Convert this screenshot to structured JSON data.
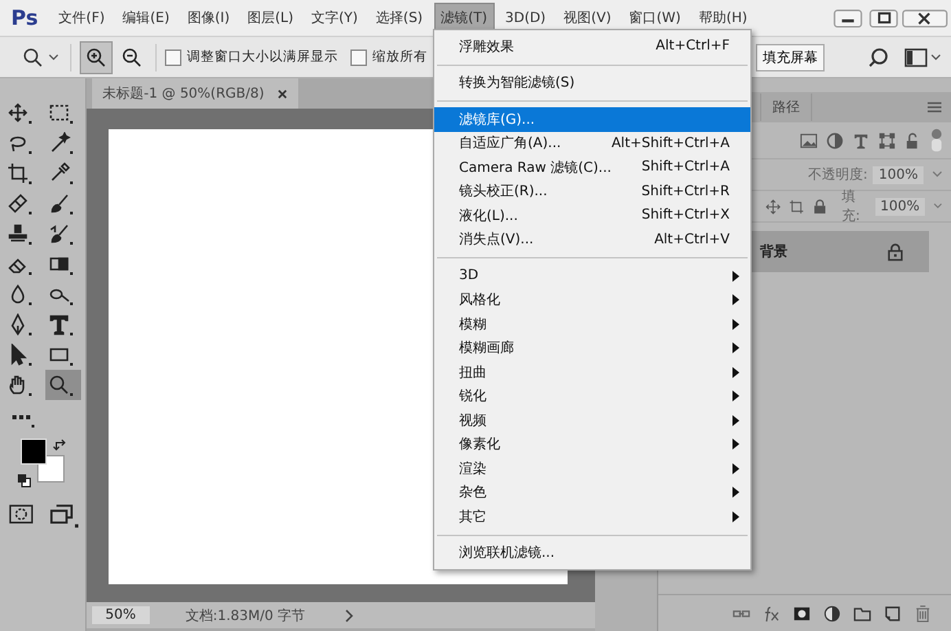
{
  "menubar": {
    "logo": "Ps",
    "items": [
      {
        "label": "文件(F)",
        "selected": false
      },
      {
        "label": "编辑(E)",
        "selected": false
      },
      {
        "label": "图像(I)",
        "selected": false
      },
      {
        "label": "图层(L)",
        "selected": false
      },
      {
        "label": "文字(Y)",
        "selected": false
      },
      {
        "label": "选择(S)",
        "selected": false
      },
      {
        "label": "滤镜(T)",
        "selected": true
      },
      {
        "label": "3D(D)",
        "selected": false
      },
      {
        "label": "视图(V)",
        "selected": false
      },
      {
        "label": "窗口(W)",
        "selected": false
      },
      {
        "label": "帮助(H)",
        "selected": false
      }
    ]
  },
  "options_bar": {
    "modes": [
      {
        "kind": "zoom-in",
        "selected": true
      },
      {
        "kind": "zoom-out",
        "selected": false
      }
    ],
    "checkboxes": [
      {
        "label": "调整窗口大小以满屏显示",
        "checked": false
      },
      {
        "label": "缩放所有",
        "checked": false
      }
    ],
    "fill_screen_button": "填充屏幕"
  },
  "tools": [
    {
      "kind": "move",
      "selected": false
    },
    {
      "kind": "marquee",
      "selected": false
    },
    {
      "kind": "lasso",
      "selected": false
    },
    {
      "kind": "wand",
      "selected": false
    },
    {
      "kind": "crop",
      "selected": false
    },
    {
      "kind": "eyedropper",
      "selected": false
    },
    {
      "kind": "healing",
      "selected": false
    },
    {
      "kind": "brush",
      "selected": false
    },
    {
      "kind": "stamp",
      "selected": false
    },
    {
      "kind": "history",
      "selected": false
    },
    {
      "kind": "eraser",
      "selected": false
    },
    {
      "kind": "gradient",
      "selected": false
    },
    {
      "kind": "blur",
      "selected": false
    },
    {
      "kind": "dodge",
      "selected": false
    },
    {
      "kind": "pen",
      "selected": false
    },
    {
      "kind": "type",
      "selected": false
    },
    {
      "kind": "pathsel",
      "selected": false
    },
    {
      "kind": "rect",
      "selected": false
    },
    {
      "kind": "hand",
      "selected": false
    },
    {
      "kind": "zoom",
      "selected": true
    }
  ],
  "document": {
    "tab_title": "未标题-1 @ 50%(RGB/8)",
    "status_zoom": "50%",
    "status_info": "文档:1.83M/0 字节"
  },
  "panel": {
    "tab": "路径",
    "opacity_label": "不透明度:",
    "opacity": "100%",
    "fill_label": "填充:",
    "fill": "100%",
    "layer": "背景"
  },
  "filter_menu": {
    "items": [
      {
        "kind": "item",
        "label": "浮雕效果",
        "shortcut": "Alt+Ctrl+F",
        "selected": false
      },
      {
        "kind": "separator"
      },
      {
        "kind": "item",
        "label": "转换为智能滤镜(S)",
        "selected": false
      },
      {
        "kind": "separator"
      },
      {
        "kind": "item",
        "label": "滤镜库(G)...",
        "selected": true
      },
      {
        "kind": "item",
        "label": "自适应广角(A)...",
        "shortcut": "Alt+Shift+Ctrl+A",
        "selected": false
      },
      {
        "kind": "item",
        "label": "Camera Raw 滤镜(C)...",
        "shortcut": "Shift+Ctrl+A",
        "selected": false
      },
      {
        "kind": "item",
        "label": "镜头校正(R)...",
        "shortcut": "Shift+Ctrl+R",
        "selected": false
      },
      {
        "kind": "item",
        "label": "液化(L)...",
        "shortcut": "Shift+Ctrl+X",
        "selected": false
      },
      {
        "kind": "item",
        "label": "消失点(V)...",
        "shortcut": "Alt+Ctrl+V",
        "selected": false
      },
      {
        "kind": "separator"
      },
      {
        "kind": "submenu",
        "label": "3D",
        "selected": false
      },
      {
        "kind": "submenu",
        "label": "风格化",
        "selected": false
      },
      {
        "kind": "submenu",
        "label": "模糊",
        "selected": false
      },
      {
        "kind": "submenu",
        "label": "模糊画廊",
        "selected": false
      },
      {
        "kind": "submenu",
        "label": "扭曲",
        "selected": false
      },
      {
        "kind": "submenu",
        "label": "锐化",
        "selected": false
      },
      {
        "kind": "submenu",
        "label": "视频",
        "selected": false
      },
      {
        "kind": "submenu",
        "label": "像素化",
        "selected": false
      },
      {
        "kind": "submenu",
        "label": "渲染",
        "selected": false
      },
      {
        "kind": "submenu",
        "label": "杂色",
        "selected": false
      },
      {
        "kind": "submenu",
        "label": "其它",
        "selected": false
      },
      {
        "kind": "separator"
      },
      {
        "kind": "item",
        "label": "浏览联机滤镜...",
        "selected": false
      }
    ]
  }
}
